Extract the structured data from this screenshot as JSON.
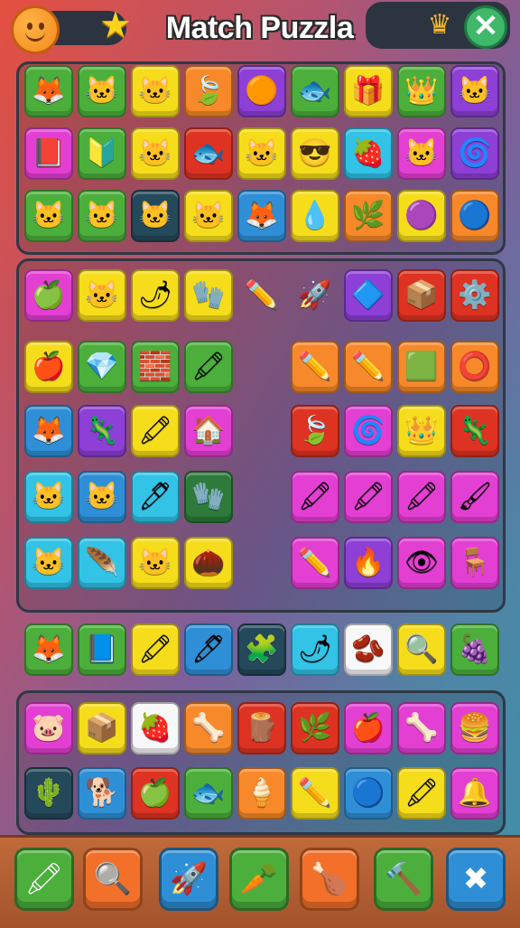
{
  "header": {
    "title": "Match Puzzla"
  },
  "icons": {
    "smiley": "smiley-face-icon",
    "star": "star-icon",
    "crown": "crown-icon",
    "close": "close-icon"
  },
  "colors": {
    "green": "#4caf3c",
    "yellow": "#f6dd1c",
    "orange": "#f7892a",
    "purple": "#8d3fd6",
    "magenta": "#e33fd3",
    "red": "#de3322",
    "cyan": "#32c3e6",
    "blue": "#2f8fd6",
    "dark": "#24495a",
    "white": "#f8f8f8",
    "darkgreen": "#2d7a3a"
  },
  "board": {
    "panel1": [
      [
        {
          "c": "green",
          "g": "🦊",
          "n": "fox-icon"
        },
        {
          "c": "green",
          "g": "🐱",
          "n": "cat-icon"
        },
        {
          "c": "yellow",
          "g": "🐱",
          "n": "cat-icon"
        },
        {
          "c": "orange",
          "g": "🍃",
          "n": "leaf-icon"
        },
        {
          "c": "purple",
          "g": "🟠",
          "n": "blob-icon"
        },
        {
          "c": "green",
          "g": "🐟",
          "n": "fish-icon"
        },
        {
          "c": "yellow",
          "g": "🎁",
          "n": "box-icon"
        },
        {
          "c": "green",
          "g": "👑",
          "n": "crowned-creature-icon"
        },
        {
          "c": "purple",
          "g": "🐱",
          "n": "cat-icon"
        }
      ],
      [
        {
          "c": "magenta",
          "g": "📕",
          "n": "book-icon"
        },
        {
          "c": "green",
          "g": "🔰",
          "n": "green-shape-icon"
        },
        {
          "c": "yellow",
          "g": "🐱",
          "n": "crowned-cat-icon"
        },
        {
          "c": "red",
          "g": "🐟",
          "n": "fish-icon"
        },
        {
          "c": "yellow",
          "g": "🐱",
          "n": "cat-icon"
        },
        {
          "c": "yellow",
          "g": "😎",
          "n": "masked-face-icon"
        },
        {
          "c": "cyan",
          "g": "🍓",
          "n": "berry-icon"
        },
        {
          "c": "magenta",
          "g": "🐱",
          "n": "cat-icon"
        },
        {
          "c": "purple",
          "g": "🌀",
          "n": "spiral-icon"
        }
      ],
      [
        {
          "c": "green",
          "g": "🐱",
          "n": "cat-icon"
        },
        {
          "c": "green",
          "g": "🐱",
          "n": "cat-icon"
        },
        {
          "c": "dark",
          "g": "🐱",
          "n": "cat-icon"
        },
        {
          "c": "yellow",
          "g": "🐱",
          "n": "cat-icon"
        },
        {
          "c": "blue",
          "g": "🦊",
          "n": "fox-icon"
        },
        {
          "c": "yellow",
          "g": "💧",
          "n": "drop-icon"
        },
        {
          "c": "orange",
          "g": "🌿",
          "n": "sprout-icon"
        },
        {
          "c": "yellow",
          "g": "🟣",
          "n": "blob-icon"
        },
        {
          "c": "orange",
          "g": "🔵",
          "n": "ring-icon"
        }
      ]
    ],
    "panel2_top": [
      {
        "c": "magenta",
        "g": "🍏",
        "n": "apple-icon"
      },
      {
        "c": "yellow",
        "g": "🐱",
        "n": "cat-icon"
      },
      {
        "c": "yellow",
        "g": "🌶",
        "n": "pepper-icon"
      },
      {
        "c": "yellow",
        "g": "🧤",
        "n": "glove-icon"
      },
      {
        "c": "none",
        "g": "✏️",
        "n": "pencil-icon"
      },
      {
        "c": "none",
        "g": "🚀",
        "n": "rocket-icon"
      },
      {
        "c": "purple",
        "g": "🔷",
        "n": "shard-icon"
      },
      {
        "c": "red",
        "g": "📦",
        "n": "crate-icon"
      },
      {
        "c": "red",
        "g": "⚙️",
        "n": "gear-icon"
      }
    ],
    "panel2_left": [
      [
        {
          "c": "yellow",
          "g": "🍎",
          "n": "apple-icon"
        },
        {
          "c": "green",
          "g": "💎",
          "n": "gem-icon"
        },
        {
          "c": "green",
          "g": "🧱",
          "n": "brick-icon"
        },
        {
          "c": "green",
          "g": "🖍",
          "n": "crayon-icon"
        }
      ],
      [
        {
          "c": "blue",
          "g": "🦊",
          "n": "fox-icon"
        },
        {
          "c": "purple",
          "g": "🦎",
          "n": "lizard-icon"
        },
        {
          "c": "yellow",
          "g": "🖍",
          "n": "crayon-icon"
        },
        {
          "c": "magenta",
          "g": "🏠",
          "n": "tower-icon"
        }
      ],
      [
        {
          "c": "cyan",
          "g": "🐱",
          "n": "cat-icon"
        },
        {
          "c": "blue",
          "g": "🐱",
          "n": "cat-icon"
        },
        {
          "c": "cyan",
          "g": "🖊",
          "n": "pen-icon"
        },
        {
          "c": "darkgreen",
          "g": "🧤",
          "n": "glove-icon"
        }
      ],
      [
        {
          "c": "cyan",
          "g": "🐱",
          "n": "cat-icon"
        },
        {
          "c": "cyan",
          "g": "🪶",
          "n": "feather-icon"
        },
        {
          "c": "yellow",
          "g": "🐱",
          "n": "cat-icon"
        },
        {
          "c": "yellow",
          "g": "🌰",
          "n": "pinecone-icon"
        }
      ]
    ],
    "panel2_right": [
      [
        {
          "c": "orange",
          "g": "✏️",
          "n": "pencil-icon"
        },
        {
          "c": "orange",
          "g": "✏️",
          "n": "pencil-icon"
        },
        {
          "c": "orange",
          "g": "🟩",
          "n": "green-block-icon"
        },
        {
          "c": "orange",
          "g": "⭕",
          "n": "ring-icon"
        }
      ],
      [
        {
          "c": "red",
          "g": "🍃",
          "n": "leaf-icon"
        },
        {
          "c": "magenta",
          "g": "🌀",
          "n": "swirl-icon"
        },
        {
          "c": "yellow",
          "g": "👑",
          "n": "crown-pot-icon"
        },
        {
          "c": "red",
          "g": "🦎",
          "n": "splat-icon"
        }
      ],
      [
        {
          "c": "magenta",
          "g": "🖍",
          "n": "crayon-icon"
        },
        {
          "c": "magenta",
          "g": "🖍",
          "n": "crayon-icon"
        },
        {
          "c": "magenta",
          "g": "🖍",
          "n": "crayon-icon"
        },
        {
          "c": "magenta",
          "g": "🖌",
          "n": "brush-icon"
        }
      ],
      [
        {
          "c": "magenta",
          "g": "✏️",
          "n": "pencil-icon"
        },
        {
          "c": "purple",
          "g": "🔥",
          "n": "flame-icon"
        },
        {
          "c": "magenta",
          "g": "👁",
          "n": "eye-icon"
        },
        {
          "c": "magenta",
          "g": "🪑",
          "n": "chair-icon"
        }
      ]
    ],
    "row_mid": [
      {
        "c": "green",
        "g": "🦊",
        "n": "fox-icon"
      },
      {
        "c": "green",
        "g": "📘",
        "n": "book-icon"
      },
      {
        "c": "yellow",
        "g": "🖍",
        "n": "crayon-icon"
      },
      {
        "c": "blue",
        "g": "🖊",
        "n": "pen-icon"
      },
      {
        "c": "dark",
        "g": "🧩",
        "n": "puzzle-icon"
      },
      {
        "c": "cyan",
        "g": "🌶",
        "n": "pepper-icon"
      },
      {
        "c": "white",
        "g": "🫘",
        "n": "bean-icon"
      },
      {
        "c": "yellow",
        "g": "🔍",
        "n": "magnifier-icon"
      },
      {
        "c": "green",
        "g": "🍇",
        "n": "berry-icon"
      }
    ],
    "panel3": [
      [
        {
          "c": "magenta",
          "g": "🐷",
          "n": "pig-icon"
        },
        {
          "c": "yellow",
          "g": "📦",
          "n": "crate-icon"
        },
        {
          "c": "white",
          "g": "🍓",
          "n": "strawberry-icon"
        },
        {
          "c": "orange",
          "g": "🦴",
          "n": "bone-icon"
        },
        {
          "c": "red",
          "g": "🪵",
          "n": "log-icon"
        },
        {
          "c": "red",
          "g": "🌿",
          "n": "leaf-icon"
        },
        {
          "c": "magenta",
          "g": "🍎",
          "n": "apple-icon"
        },
        {
          "c": "magenta",
          "g": "🦴",
          "n": "bone-icon"
        },
        {
          "c": "magenta",
          "g": "🍔",
          "n": "burger-icon"
        }
      ],
      [
        {
          "c": "dark",
          "g": "🌵",
          "n": "plant-icon"
        },
        {
          "c": "blue",
          "g": "🐕",
          "n": "dog-icon"
        },
        {
          "c": "red",
          "g": "🍏",
          "n": "apple-icon"
        },
        {
          "c": "green",
          "g": "🐟",
          "n": "fish-icon"
        },
        {
          "c": "orange",
          "g": "🍦",
          "n": "cone-icon"
        },
        {
          "c": "yellow",
          "g": "✏️",
          "n": "pencil-icon"
        },
        {
          "c": "blue",
          "g": "🔵",
          "n": "ring-icon"
        },
        {
          "c": "yellow",
          "g": "🖍",
          "n": "crayon-icon"
        },
        {
          "c": "magenta",
          "g": "🔔",
          "n": "bell-icon"
        }
      ]
    ]
  },
  "toolbar": [
    {
      "c": "#4caf3c",
      "g": "🖍",
      "n": "crayon-tool-button"
    },
    {
      "c": "#f2702a",
      "g": "🔍",
      "n": "magnifier-tool-button"
    },
    {
      "c": "#2f8fd6",
      "g": "🚀",
      "n": "rocket-tool-button"
    },
    {
      "c": "#4caf3c",
      "g": "🥕",
      "n": "carrot-tool-button"
    },
    {
      "c": "#f2702a",
      "g": "🍗",
      "n": "drumstick-tool-button"
    },
    {
      "c": "#4caf3c",
      "g": "🔨",
      "n": "hammer-tool-button"
    },
    {
      "c": "#2f8fd6",
      "g": "✖",
      "n": "cancel-tool-button"
    }
  ]
}
